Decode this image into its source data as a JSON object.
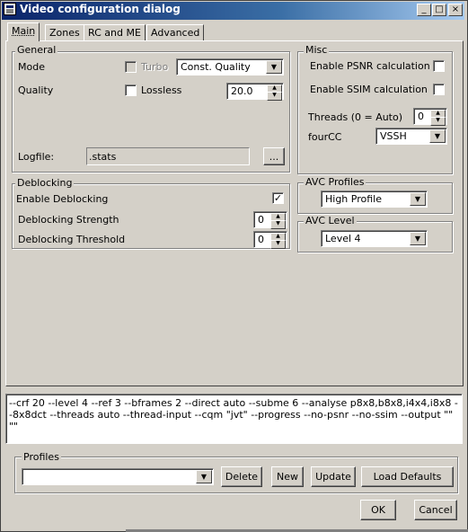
{
  "window": {
    "title": "Video configuration dialog",
    "buttons": {
      "minimize": "_",
      "maximize": "□",
      "close": "×"
    }
  },
  "tabs": [
    {
      "label": "Main",
      "active": true
    },
    {
      "label": "Zones",
      "active": false
    },
    {
      "label": "RC and ME",
      "active": false
    },
    {
      "label": "Advanced",
      "active": false
    }
  ],
  "general": {
    "legend": "General",
    "mode_label": "Mode",
    "turbo_label": "Turbo",
    "turbo_checked": false,
    "mode_value": "Const. Quality",
    "quality_label": "Quality",
    "lossless_label": "Lossless",
    "lossless_checked": false,
    "quality_value": "20.0",
    "logfile_label": "Logfile:",
    "logfile_value": ".stats",
    "browse_label": "..."
  },
  "misc": {
    "legend": "Misc",
    "psnr_label": "Enable PSNR calculation",
    "psnr_checked": false,
    "ssim_label": "Enable SSIM calculation",
    "ssim_checked": false,
    "threads_label": "Threads (0 = Auto)",
    "threads_value": "0",
    "fourcc_label": "fourCC",
    "fourcc_value": "VSSH"
  },
  "deblocking": {
    "legend": "Deblocking",
    "enable_label": "Enable Deblocking",
    "enable_checked": true,
    "strength_label": "Deblocking Strength",
    "strength_value": "0",
    "threshold_label": "Deblocking Threshold",
    "threshold_value": "0"
  },
  "avc_profiles": {
    "legend": "AVC Profiles",
    "value": "High Profile"
  },
  "avc_level": {
    "legend": "AVC Level",
    "value": "Level 4"
  },
  "command_line": "--crf 20 --level 4 --ref 3 --bframes 2 --direct auto --subme 6 --analyse p8x8,b8x8,i4x4,i8x8 --8x8dct --threads auto --thread-input --cqm \"jvt\" --progress --no-psnr --no-ssim --output \"\" \"\"",
  "profiles": {
    "legend": "Profiles",
    "selected": "",
    "delete_label": "Delete",
    "new_label": "New",
    "update_label": "Update",
    "load_defaults_label": "Load Defaults"
  },
  "footer": {
    "ok_label": "OK",
    "cancel_label": "Cancel"
  },
  "icons": {
    "checkmark": "✓",
    "dropdown": "▼",
    "spin_up": "▲",
    "spin_down": "▼"
  }
}
